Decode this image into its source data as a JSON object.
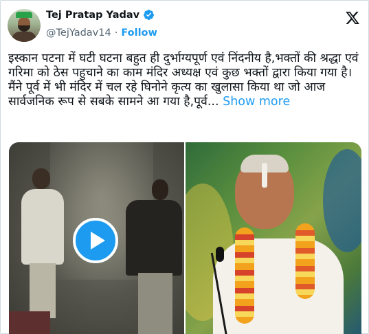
{
  "author": {
    "display_name": "Tej Pratap Yadav",
    "handle": "@TejYadav14",
    "separator": "·",
    "follow_label": "Follow",
    "verified": true,
    "verified_color": "#1d9bf0"
  },
  "tweet": {
    "paragraph_1": "इस्कान पटना में घटी घटना बहुत ही दुर्भाग्यपूर्ण एवं निंदनीय  है,भक्तों की श्रद्धा एवं गरिमा को ठेस पहुचाने का काम मंदिर अध्यक्ष एवं कुछ भक्तों द्वारा किया गया है।",
    "paragraph_2": "मैंने पूर्व में भी मंदिर में चल रहे घिनोने कृत्य का खुलासा किया था जो आज सार्वजनिक रूप से सबके सामने आ गया है,पूर्व...",
    "show_more_label": "Show more"
  },
  "media": {
    "left": {
      "kind": "video",
      "icon": "play-icon"
    },
    "right": {
      "kind": "photo"
    }
  },
  "icons": {
    "platform": "x-logo-icon",
    "verified": "verified-badge-icon"
  },
  "colors": {
    "accent": "#1d9bf0",
    "text": "#0f1419",
    "muted": "#536471"
  }
}
